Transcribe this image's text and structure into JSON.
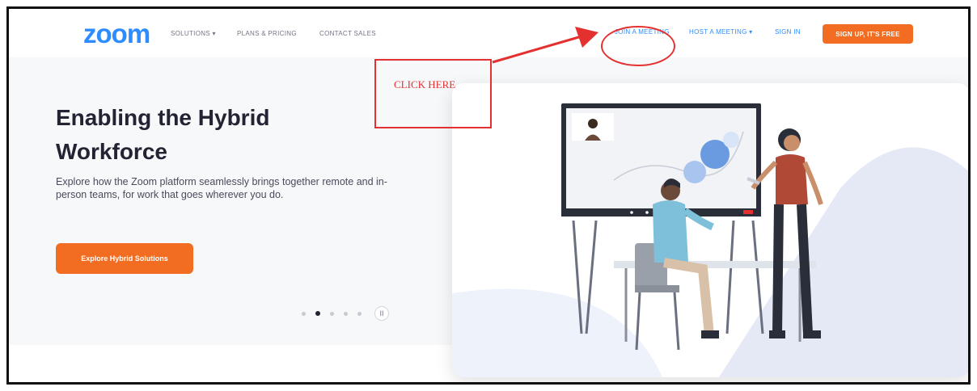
{
  "nav": {
    "logo": "zoom",
    "left_items": [
      "SOLUTIONS ▾",
      "PLANS & PRICING",
      "CONTACT SALES"
    ],
    "join_meeting": "JOIN A MEETING",
    "host_meeting": "HOST A MEETING ▾",
    "sign_in": "SIGN IN",
    "signup": "SIGN UP, IT'S FREE"
  },
  "hero": {
    "title_line1": "Enabling the Hybrid",
    "title_line2": "Workforce",
    "description": "Explore how the Zoom platform seamlessly brings together remote and in-person teams, for work that goes wherever you do.",
    "cta": "Explore Hybrid Solutions",
    "carousel": {
      "slides": 5,
      "active_index": 1,
      "pause_symbol": "II"
    }
  },
  "annotation": {
    "text": "CLICK HERE",
    "color": "#e53030"
  },
  "colors": {
    "brand_blue": "#2d8cff",
    "cta_orange": "#f26d21"
  }
}
